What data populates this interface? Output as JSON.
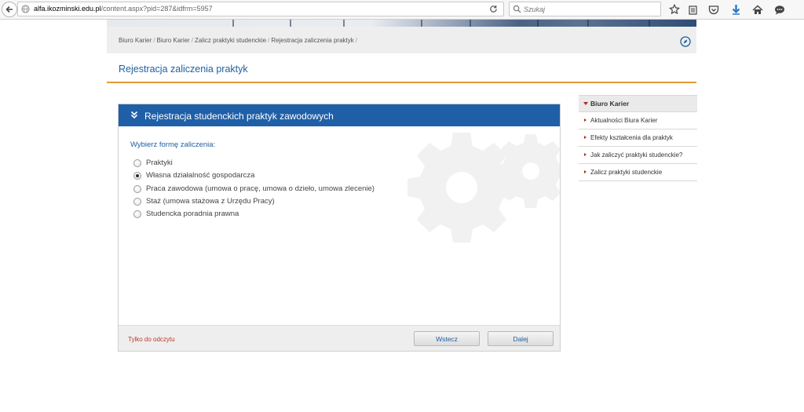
{
  "browser": {
    "url_domain": "alfa.ikozminski.edu.pl",
    "url_path": "/content.aspx?pid=287&idfrm=5957",
    "search_placeholder": "Szukaj"
  },
  "breadcrumb": [
    "Biuro Karier",
    "Biuro Karier",
    "Zalicz praktyki studenckie",
    "Rejestracja zaliczenia praktyk"
  ],
  "breadcrumb_separator": "/",
  "page_title": "Rejestracja zaliczenia praktyk",
  "panel": {
    "title": "Rejestracja studenckich praktyk zawodowych",
    "form_label": "Wybierz formę zaliczenia:",
    "options": [
      {
        "label": "Praktyki",
        "checked": false
      },
      {
        "label": "Własna działalność gospodarcza",
        "checked": true
      },
      {
        "label": "Praca zawodowa (umowa o pracę, umowa o dzieło, umowa zlecenie)",
        "checked": false
      },
      {
        "label": "Staż (umowa stażowa z Urzędu Pracy)",
        "checked": false
      },
      {
        "label": "Studencka poradnia prawna",
        "checked": false
      }
    ],
    "readonly_note": "Tylko do odczytu",
    "back_label": "Wstecz",
    "next_label": "Dalej"
  },
  "sidebar": {
    "header": "Biuro Karier",
    "items": [
      "Aktualności Biura Karier",
      "Efekty kształcenia dla praktyk",
      "Jak zaliczyć praktyki studenckie?",
      "Zalicz praktyki studenckie"
    ]
  },
  "colors": {
    "accent_blue": "#1f5fa7",
    "link_blue": "#1d5f9e",
    "orange_rule": "#e29d35",
    "readonly_red": "#c0392b",
    "bullet_red": "#b1281f"
  },
  "icons": [
    "back-arrow-icon",
    "globe-icon",
    "reload-icon",
    "search-icon",
    "bookmark-star-icon",
    "reading-list-icon",
    "pocket-icon",
    "download-icon",
    "home-icon",
    "chat-icon",
    "compass-icon",
    "double-chevron-down-icon",
    "gear-watermark-icon"
  ]
}
